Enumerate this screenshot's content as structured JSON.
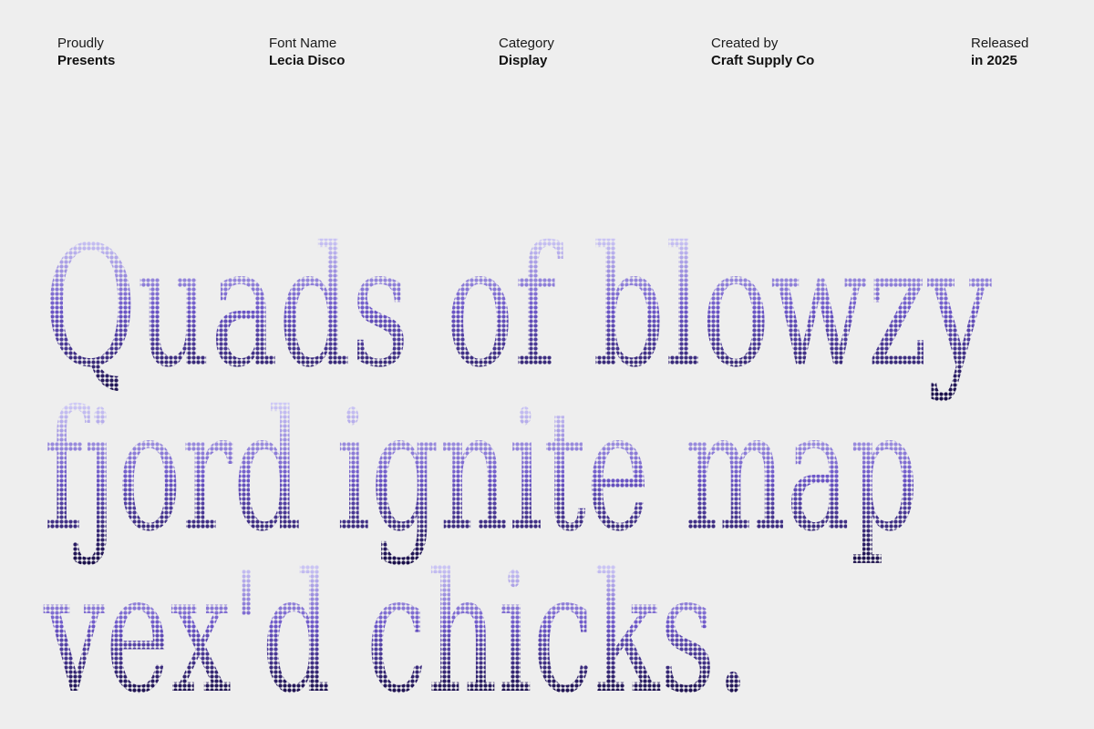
{
  "meta": [
    {
      "label": "Proudly",
      "value": "Presents"
    },
    {
      "label": "Font Name",
      "value": "Lecia Disco"
    },
    {
      "label": "Category",
      "value": "Display"
    },
    {
      "label": "Created by",
      "value": "Craft Supply Co"
    },
    {
      "label": "Released",
      "value": "in 2025"
    }
  ],
  "specimen": {
    "lines": [
      "Quads of blowzy",
      "fjord ignite map",
      "vex'd chicks."
    ]
  },
  "colors": {
    "background": "#eeeeee",
    "text": "#111111",
    "gradient_top": "#d9d6fb",
    "gradient_mid": "#6b55c8",
    "gradient_bottom": "#1a0f4a"
  }
}
